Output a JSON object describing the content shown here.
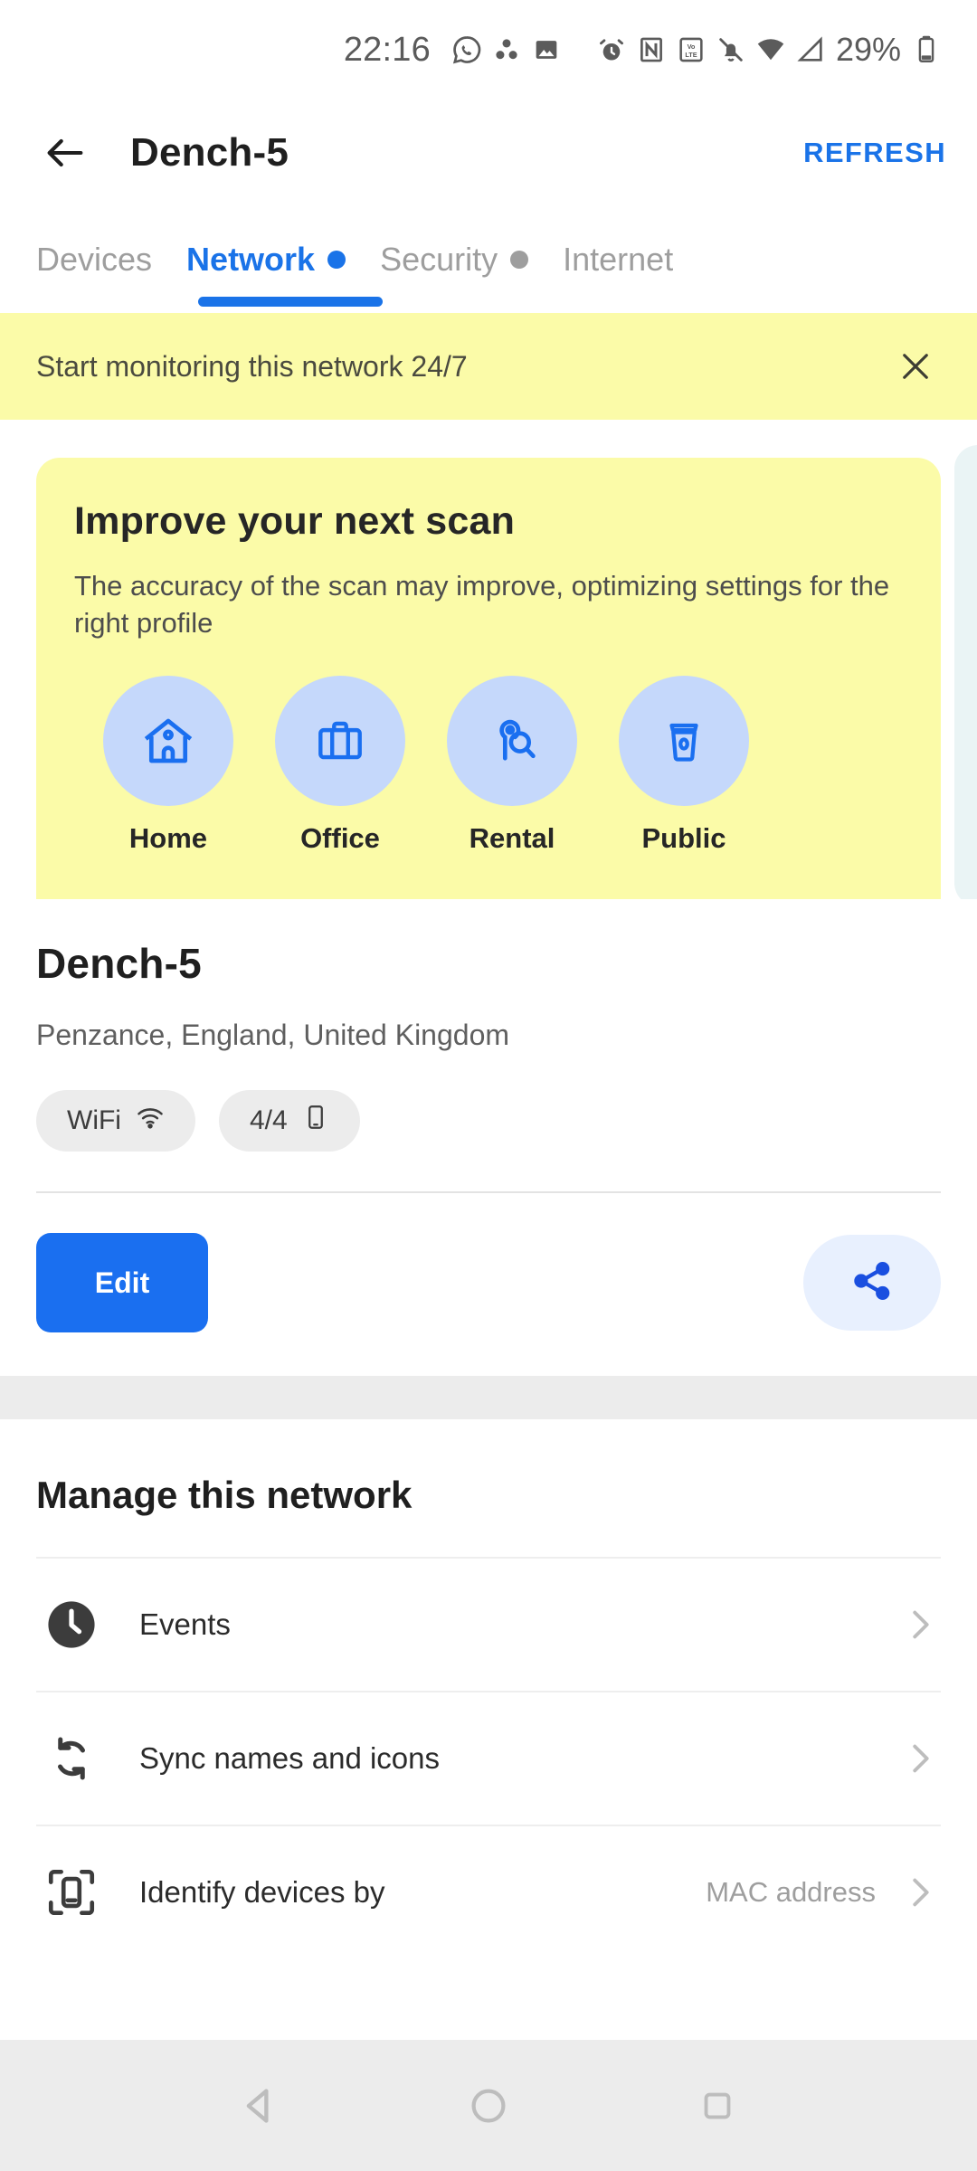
{
  "status_bar": {
    "time": "22:16",
    "battery_percent": "29%",
    "icons": [
      "whatsapp-icon",
      "asana-dots-icon",
      "gallery-icon",
      "alarm-icon",
      "nfc-icon",
      "volte-icon",
      "mute-bell-icon",
      "wifi-icon",
      "cell-signal-icon",
      "battery-icon"
    ]
  },
  "app_bar": {
    "back": "back-arrow-icon",
    "title": "Dench-5",
    "refresh_label": "REFRESH"
  },
  "tabs": [
    {
      "label": "Devices",
      "active": false,
      "dot": false
    },
    {
      "label": "Network",
      "active": true,
      "dot": true
    },
    {
      "label": "Security",
      "active": false,
      "dot": true
    },
    {
      "label": "Internet",
      "active": false,
      "dot": false
    }
  ],
  "banner": {
    "text": "Start monitoring this network 24/7",
    "close": "close-icon"
  },
  "scan_card": {
    "title": "Improve your next scan",
    "subtitle": "The accuracy of the scan may improve, optimizing settings for the right profile",
    "profiles": [
      {
        "label": "Home",
        "icon": "house-icon"
      },
      {
        "label": "Office",
        "icon": "briefcase-icon"
      },
      {
        "label": "Rental",
        "icon": "key-search-icon"
      },
      {
        "label": "Public",
        "icon": "coffee-cup-icon"
      }
    ]
  },
  "network": {
    "name": "Dench-5",
    "location": "Penzance, England, United Kingdom",
    "chips": [
      {
        "label": "WiFi",
        "icon": "wifi-icon"
      },
      {
        "label": "4/4",
        "icon": "phone-icon"
      }
    ],
    "edit_label": "Edit",
    "share_icon": "share-icon"
  },
  "manage": {
    "title": "Manage this network",
    "rows": [
      {
        "label": "Events",
        "icon": "clock-icon",
        "value": ""
      },
      {
        "label": "Sync names and icons",
        "icon": "sync-icon",
        "value": ""
      },
      {
        "label": "Identify devices by",
        "icon": "scan-device-icon",
        "value": "MAC address"
      }
    ]
  },
  "nav_bar": {
    "back": "nav-back-icon",
    "home": "nav-home-icon",
    "recents": "nav-recents-icon"
  },
  "colors": {
    "accent_blue": "#1a73e8",
    "button_blue": "#1a6ff0",
    "banner_yellow": "#fbfba8",
    "peek_card": "#eaf4f5",
    "grey_divider": "#ececec"
  }
}
